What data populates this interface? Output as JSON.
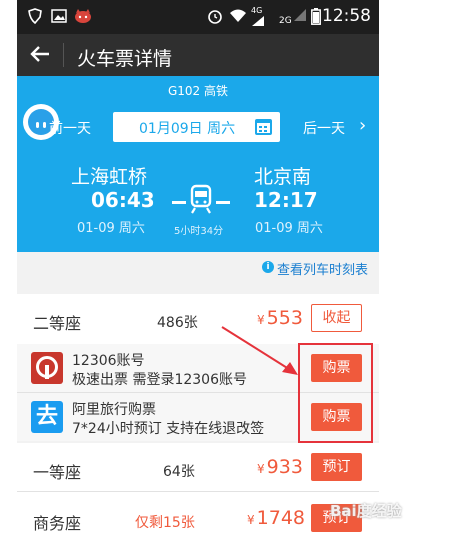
{
  "status_bar": {
    "time": "12:58",
    "icons": [
      "shield-icon",
      "image-icon",
      "cat-icon",
      "alarm-icon",
      "wifi-icon",
      "signal-4g-icon",
      "signal-2g-icon",
      "battery-icon"
    ],
    "net_4g": "4G",
    "net_2g": "2G"
  },
  "app_bar": {
    "back_icon": "arrow-left-icon",
    "title": "火车票详情"
  },
  "train": {
    "code": "G102 高铁",
    "prev_day": "前一天",
    "next_day": "后一天",
    "date": "01月09日 周六",
    "from_station": "上海虹桥",
    "to_station": "北京南",
    "depart_time": "06:43",
    "arrive_time": "12:17",
    "depart_date": "01-09 周六",
    "arrive_date": "01-09 周六",
    "duration": "5小时34分"
  },
  "schedule_link": "查看列车时刻表",
  "seats": [
    {
      "name": "二等座",
      "left": "486张",
      "price_symbol": "¥",
      "price": "553",
      "button": "收起"
    },
    {
      "name": "一等座",
      "left": "64张",
      "price_symbol": "¥",
      "price": "933",
      "button": "预订"
    },
    {
      "name": "商务座",
      "left": "仅剩15张",
      "price_symbol": "¥",
      "price": "1748",
      "button": "预订"
    }
  ],
  "agents": [
    {
      "title": "12306账号",
      "desc": "极速出票 需登录12306账号",
      "button": "购票"
    },
    {
      "title": "阿里旅行购票",
      "desc": "7*24小时预订 支持在线退改签",
      "button": "购票",
      "logo_char": "去"
    }
  ],
  "watermark": "Bai度经验",
  "colors": {
    "header_blue": "#1ba8ea",
    "accent_red": "#f05a3c",
    "appbar": "#2f2f2f",
    "annotation_red": "#e5333b"
  }
}
